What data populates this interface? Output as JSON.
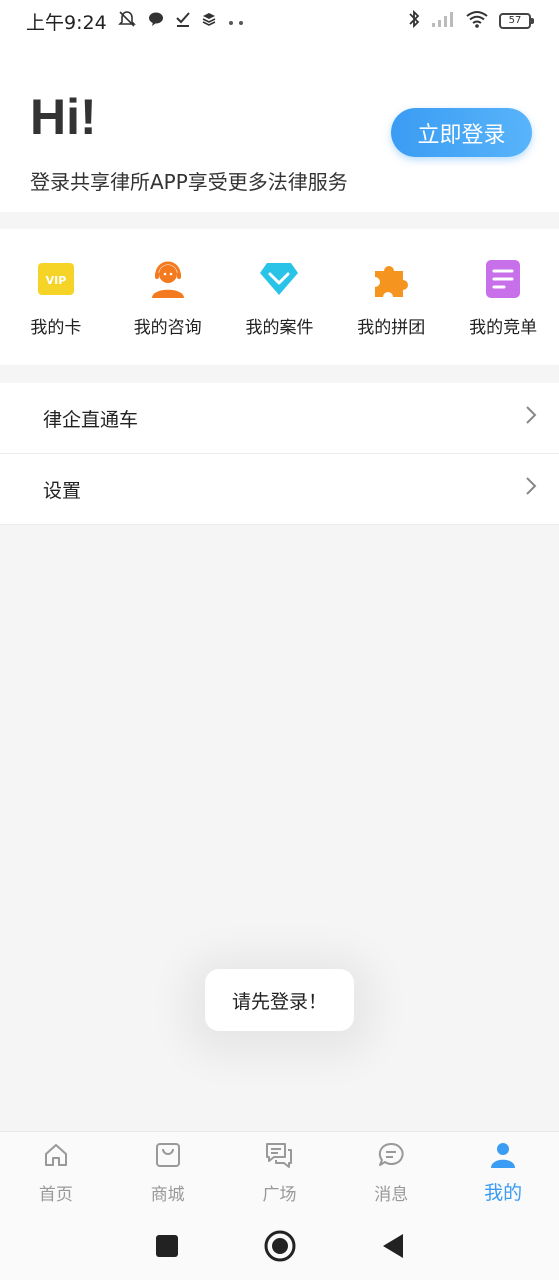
{
  "status_bar": {
    "time": "上午9:24",
    "battery": "57",
    "icons": [
      "mute-bell-icon",
      "chat-icon",
      "check-icon",
      "layers-icon",
      "more-icon",
      "bluetooth-icon",
      "signal-icon",
      "wifi-icon",
      "battery-icon"
    ]
  },
  "header": {
    "greeting": "Hi!",
    "subtitle": "登录共享律所APP享受更多法律服务",
    "login_label": "立即登录"
  },
  "quick_links": [
    {
      "label": "我的卡",
      "icon": "vip-card-icon",
      "color": "#f5d327"
    },
    {
      "label": "我的咨询",
      "icon": "headset-person-icon",
      "color": "#f47a1f"
    },
    {
      "label": "我的案件",
      "icon": "diamond-icon",
      "color": "#29c3e8"
    },
    {
      "label": "我的拼团",
      "icon": "puzzle-icon",
      "color": "#f5951f"
    },
    {
      "label": "我的竞单",
      "icon": "document-icon",
      "color": "#c86fea"
    }
  ],
  "menu": [
    {
      "label": "律企直通车"
    },
    {
      "label": "设置"
    }
  ],
  "toast": "请先登录！",
  "tabs": [
    {
      "label": "首页",
      "icon": "home-icon"
    },
    {
      "label": "商城",
      "icon": "shopping-bag-icon"
    },
    {
      "label": "广场",
      "icon": "chat-bubbles-icon"
    },
    {
      "label": "消息",
      "icon": "message-icon"
    },
    {
      "label": "我的",
      "icon": "user-icon",
      "active": true
    }
  ],
  "colors": {
    "accent": "#3a9cf3",
    "inactive_tab": "#999999"
  }
}
